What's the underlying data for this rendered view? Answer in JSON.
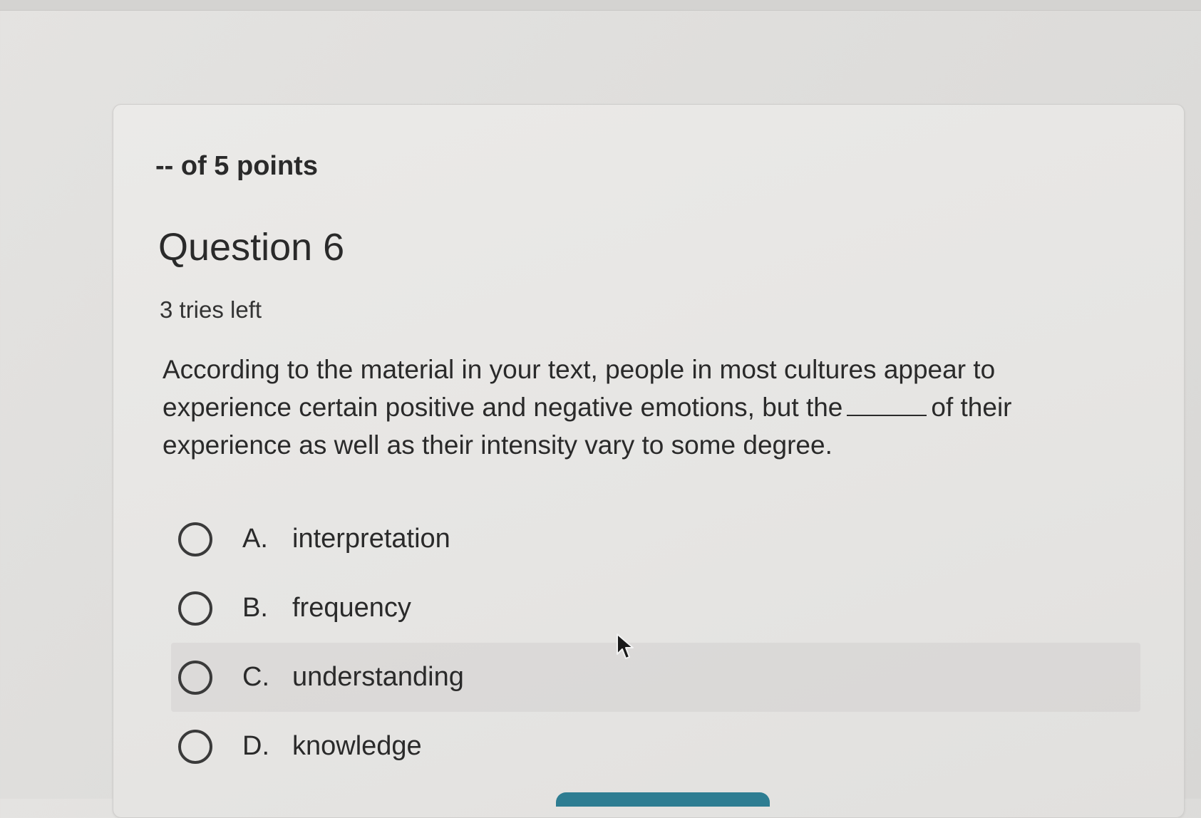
{
  "header": {
    "points_label": "-- of 5 points"
  },
  "question": {
    "title": "Question 6",
    "tries_left": "3 tries left",
    "text_part1": "According to the material in your text, people in most cultures appear to experience certain positive and negative emotions, but the",
    "text_part2": "of their experience as well as their intensity vary to some degree."
  },
  "options": [
    {
      "letter": "A.",
      "text": "interpretation",
      "selected": false
    },
    {
      "letter": "B.",
      "text": "frequency",
      "selected": false
    },
    {
      "letter": "C.",
      "text": "understanding",
      "selected": false
    },
    {
      "letter": "D.",
      "text": "knowledge",
      "selected": false
    }
  ],
  "colors": {
    "background": "#dfdedc",
    "card": "#e8e7e5",
    "text": "#2a2a2a",
    "accent_button": "#2e7d92"
  },
  "icons": {
    "cursor": "mouse-pointer-icon",
    "radio": "radio-circle-icon"
  }
}
